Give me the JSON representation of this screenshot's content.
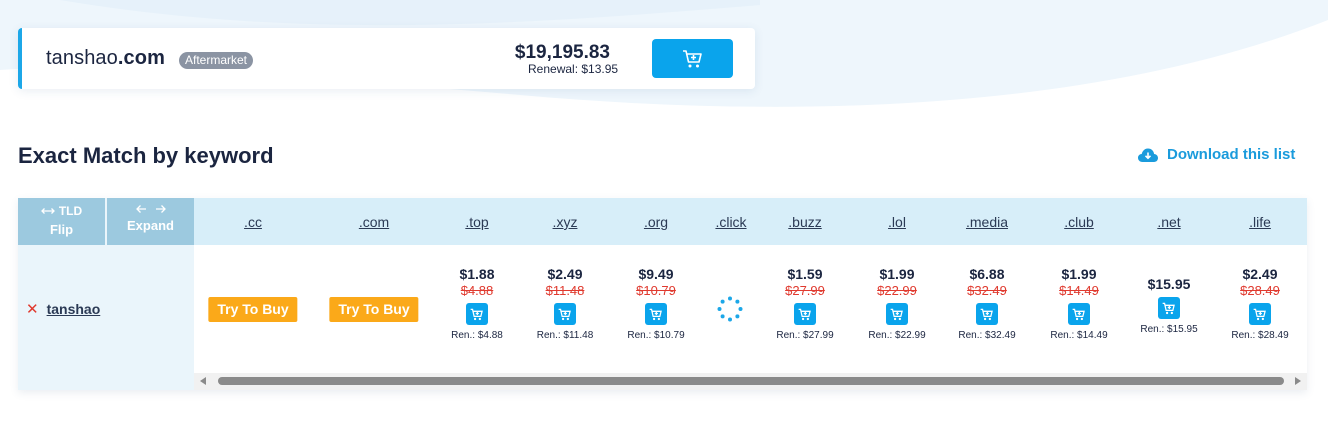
{
  "featured": {
    "name": "tanshao",
    "tld": ".com",
    "badge": "Aftermarket",
    "price": "$19,195.83",
    "renewal": "Renewal: $13.95"
  },
  "section": {
    "title": "Exact Match by keyword",
    "download_label": "Download this list"
  },
  "table": {
    "flip": {
      "top": "TLD",
      "bottom": "Flip"
    },
    "expand": {
      "bottom": "Expand"
    },
    "keyword": "tanshao",
    "tlds": [
      ".cc",
      ".com",
      ".top",
      ".xyz",
      ".org",
      ".click",
      ".buzz",
      ".lol",
      ".media",
      ".club",
      ".net",
      ".life"
    ],
    "try_label": "Try To Buy",
    "prices": {
      "top": {
        "price": "$1.88",
        "old": "$4.88",
        "ren": "Ren.: $4.88"
      },
      "xyz": {
        "price": "$2.49",
        "old": "$11.48",
        "ren": "Ren.: $11.48"
      },
      "org": {
        "price": "$9.49",
        "old": "$10.79",
        "ren": "Ren.: $10.79"
      },
      "buzz": {
        "price": "$1.59",
        "old": "$27.99",
        "ren": "Ren.: $27.99"
      },
      "lol": {
        "price": "$1.99",
        "old": "$22.99",
        "ren": "Ren.: $22.99"
      },
      "media": {
        "price": "$6.88",
        "old": "$32.49",
        "ren": "Ren.: $32.49"
      },
      "club": {
        "price": "$1.99",
        "old": "$14.49",
        "ren": "Ren.: $14.49"
      },
      "net": {
        "price": "$15.95",
        "ren": "Ren.: $15.95"
      },
      "life": {
        "price": "$2.49",
        "old": "$28.49",
        "ren": "Ren.: $28.49"
      }
    }
  },
  "colors": {
    "accent": "#0aa4ec",
    "try_button": "#fba919",
    "strike": "#e03a2f",
    "header_bg": "#d7eef9",
    "flip_bg": "#9cc9df"
  },
  "icons": [
    "cart-plus-icon",
    "cloud-download-icon",
    "swap-horizontal-icon",
    "expand-arrows-icon",
    "remove-x-icon",
    "loading-spinner-icon"
  ]
}
